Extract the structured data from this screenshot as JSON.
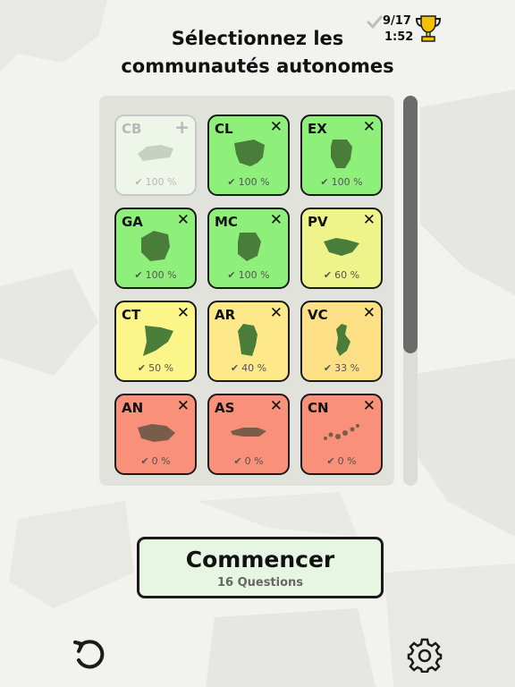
{
  "header": {
    "title_line1": "Sélectionnez les",
    "title_line2": "communautés autonomes",
    "score": "9/17",
    "timer": "1:52"
  },
  "tiles": [
    {
      "code": "CB",
      "action": "+",
      "percent": "100 %",
      "state": "disabled",
      "color": "#eef6ea"
    },
    {
      "code": "CL",
      "action": "✕",
      "percent": "100 %",
      "state": "selected",
      "color": "#8ef07a"
    },
    {
      "code": "EX",
      "action": "✕",
      "percent": "100 %",
      "state": "selected",
      "color": "#8ef07a"
    },
    {
      "code": "GA",
      "action": "✕",
      "percent": "100 %",
      "state": "selected",
      "color": "#8ef07a"
    },
    {
      "code": "MC",
      "action": "✕",
      "percent": "100 %",
      "state": "selected",
      "color": "#8ef07a"
    },
    {
      "code": "PV",
      "action": "✕",
      "percent": "60 %",
      "state": "selected",
      "color": "#eef48a"
    },
    {
      "code": "CT",
      "action": "✕",
      "percent": "50 %",
      "state": "selected",
      "color": "#fbf58a"
    },
    {
      "code": "AR",
      "action": "✕",
      "percent": "40 %",
      "state": "selected",
      "color": "#fde98a"
    },
    {
      "code": "VC",
      "action": "✕",
      "percent": "33 %",
      "state": "selected",
      "color": "#fde085"
    },
    {
      "code": "AN",
      "action": "✕",
      "percent": "0 %",
      "state": "selected",
      "color": "#f8907a"
    },
    {
      "code": "AS",
      "action": "✕",
      "percent": "0 %",
      "state": "selected",
      "color": "#f8907a"
    },
    {
      "code": "CN",
      "action": "✕",
      "percent": "0 %",
      "state": "selected",
      "color": "#f8907a"
    }
  ],
  "start_button": {
    "label": "Commencer",
    "subtitle": "16 Questions"
  },
  "icons": {
    "check": "check-icon",
    "trophy": "trophy-icon",
    "undo": "undo-icon",
    "settings": "gear-icon"
  },
  "colors": {
    "trophy": "#f2c200",
    "region_shape": "#4b7d3a",
    "scroll_thumb": "#6b6b6b"
  }
}
